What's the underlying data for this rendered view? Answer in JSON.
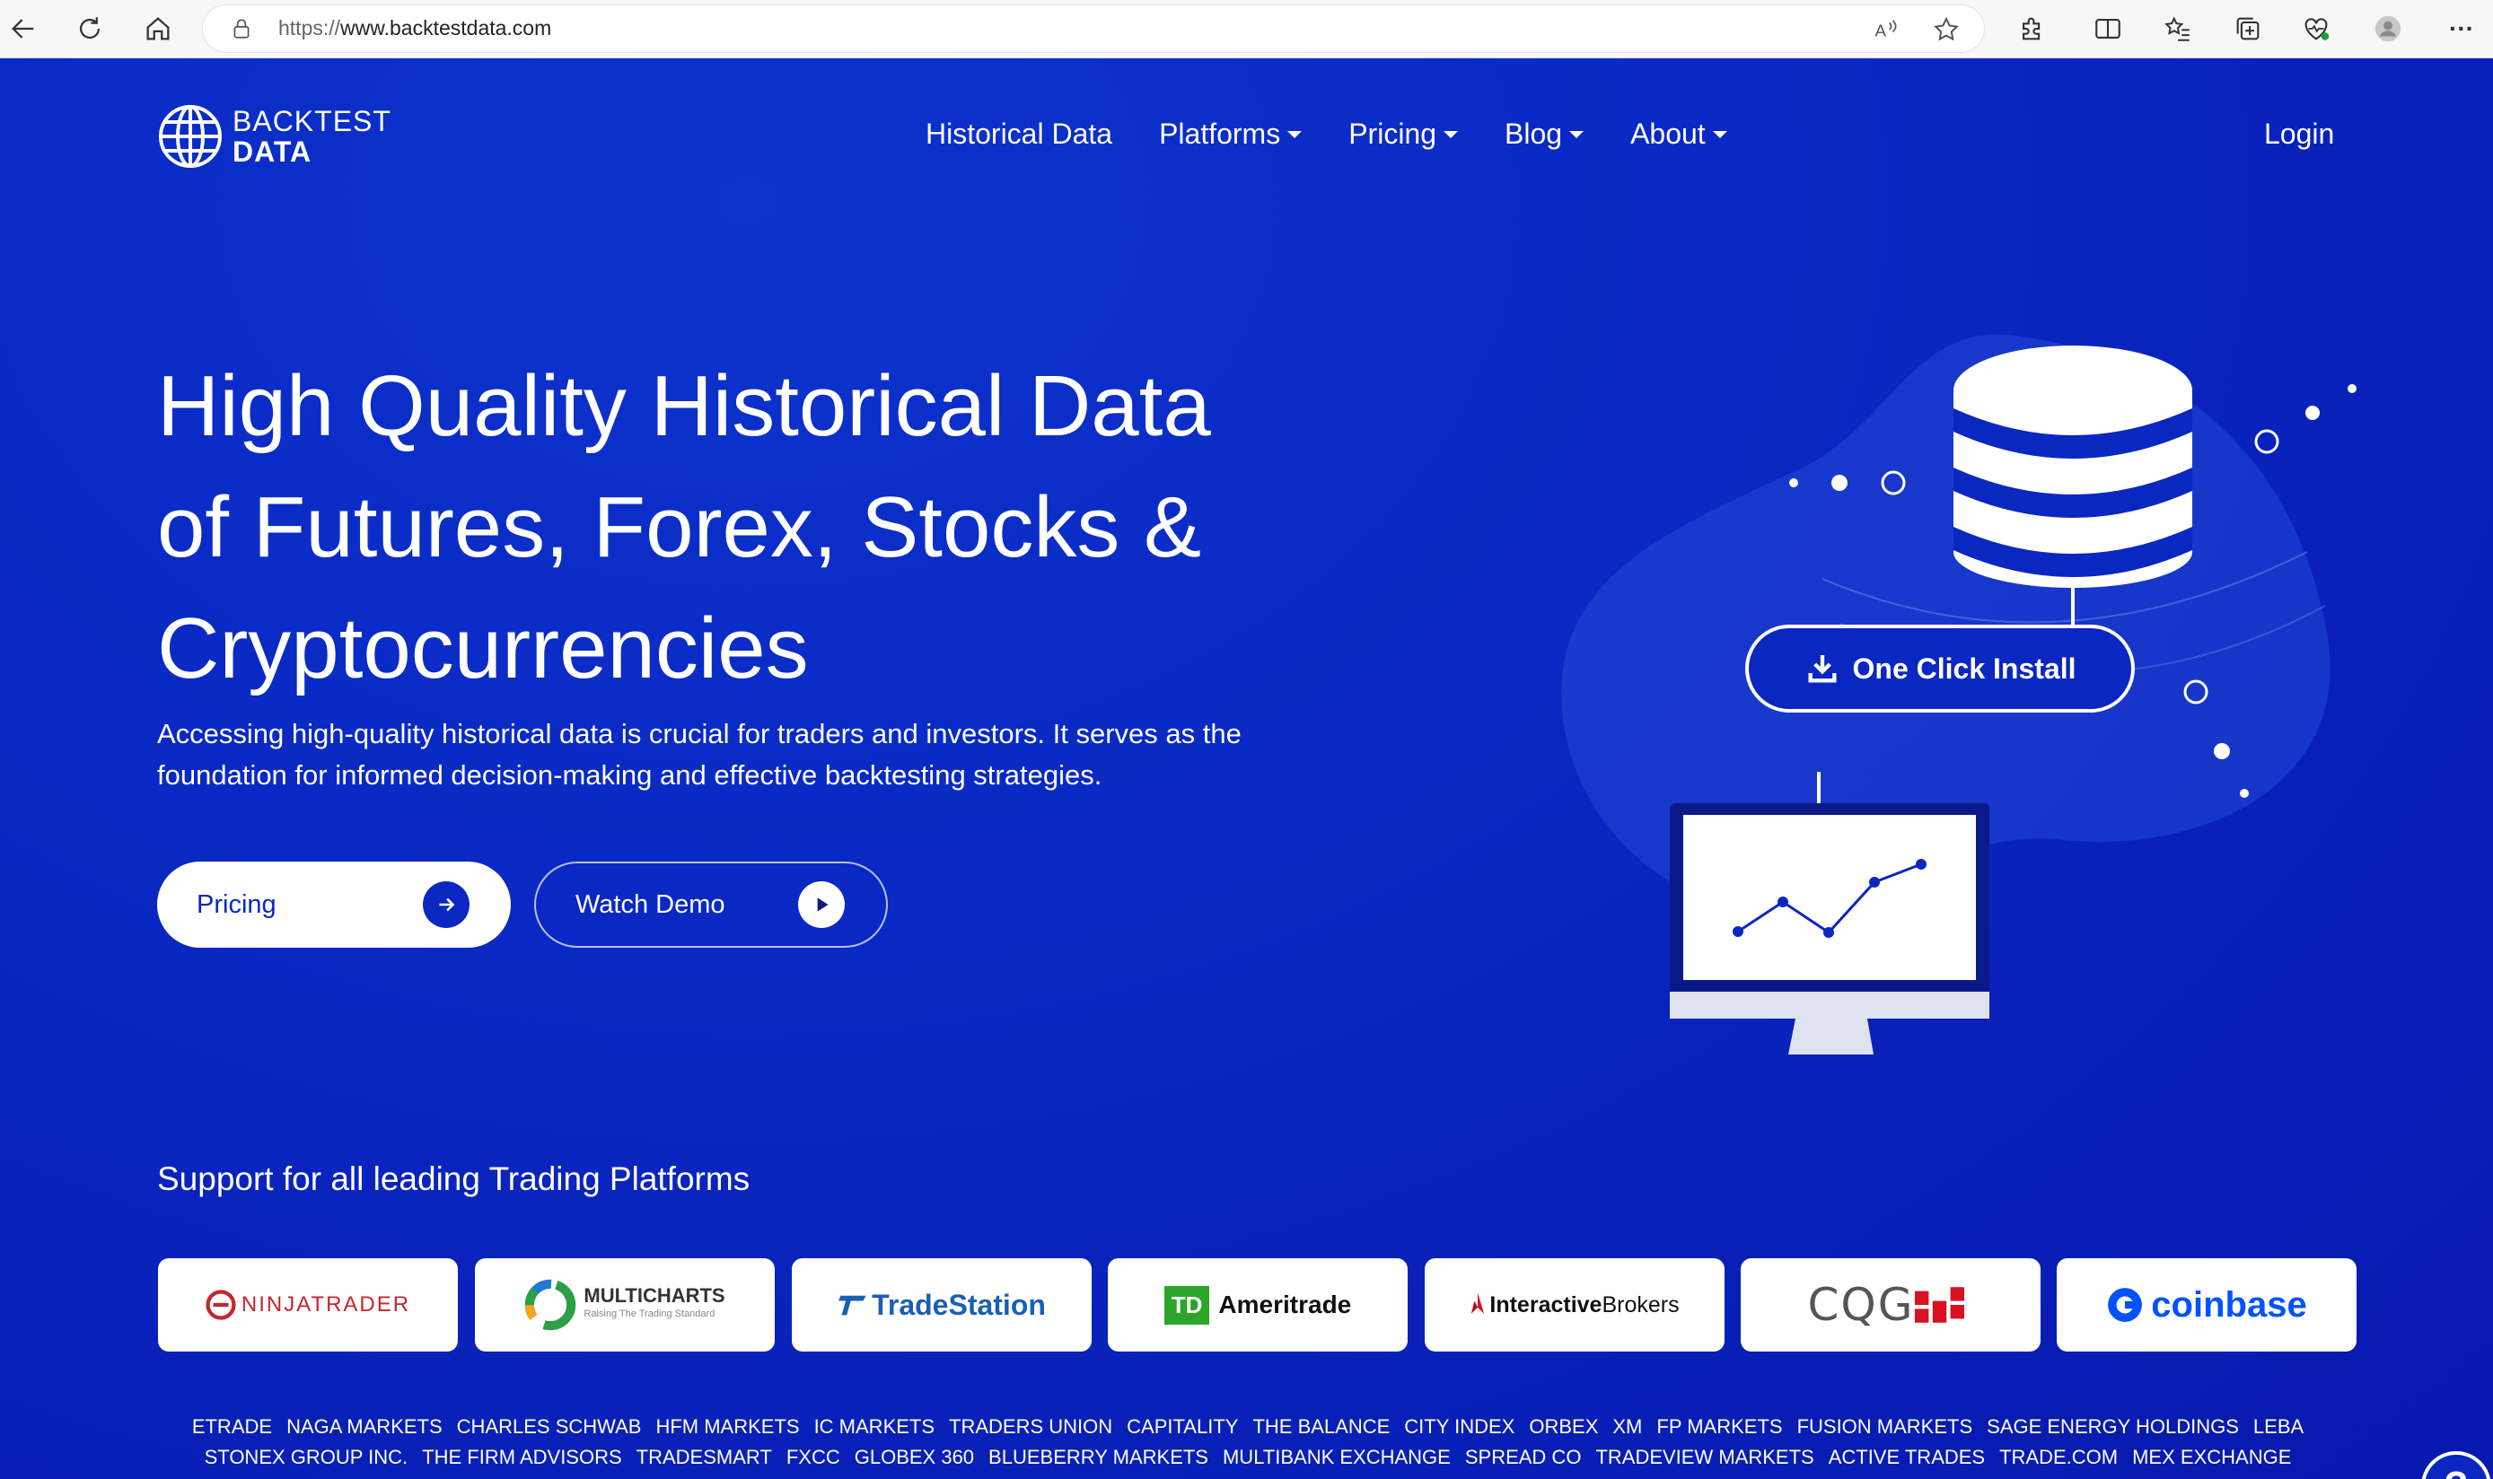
{
  "browser": {
    "url_prefix": "https://",
    "url_host": "www.backtestdata.com",
    "more_label": "···"
  },
  "site": {
    "logo_line1": "BACKTEST",
    "logo_line2": "DATA",
    "nav": [
      {
        "label": "Historical Data",
        "dropdown": false
      },
      {
        "label": "Platforms",
        "dropdown": true
      },
      {
        "label": "Pricing",
        "dropdown": true
      },
      {
        "label": "Blog",
        "dropdown": true
      },
      {
        "label": "About",
        "dropdown": true
      }
    ],
    "login_label": "Login"
  },
  "hero": {
    "title_line1": "High Quality Historical Data",
    "title_line2": "of Futures, Forex, Stocks &",
    "title_line3": "Cryptocurrencies",
    "subtitle_line1": "Accessing high-quality historical data is crucial for traders and investors. It serves as the",
    "subtitle_line2": "foundation for informed decision-making and effective backtesting strategies.",
    "pricing_button": "Pricing",
    "demo_button": "Watch Demo",
    "install_label": "One Click Install"
  },
  "support": {
    "title": "Support for all leading Trading Platforms",
    "partners": [
      {
        "name": "NINJATRADER",
        "icon": "ninjatrader-logo"
      },
      {
        "name": "MULTICHARTS",
        "tagline": "Raising The Trading Standard",
        "icon": "multicharts-logo"
      },
      {
        "name": "TradeStation",
        "icon": "tradestation-logo"
      },
      {
        "name": "Ameritrade",
        "prefix": "TD",
        "icon": "td-ameritrade-logo"
      },
      {
        "name_bold": "Interactive",
        "name_rest": "Brokers",
        "icon": "interactive-brokers-logo"
      },
      {
        "name": "CQG",
        "icon": "cqg-logo"
      },
      {
        "name": "coinbase",
        "icon": "coinbase-logo"
      }
    ],
    "brokers_row1": [
      "ETRADE",
      "NAGA MARKETS",
      "CHARLES SCHWAB",
      "HFM MARKETS",
      "IC MARKETS",
      "TRADERS UNION",
      "CAPITALITY",
      "THE BALANCE",
      "CITY INDEX",
      "ORBEX",
      "XM",
      "FP MARKETS",
      "FUSION MARKETS",
      "SAGE ENERGY HOLDINGS",
      "LEBA"
    ],
    "brokers_row2": [
      "STONEX GROUP INC.",
      "THE FIRM ADVISORS",
      "TRADESMART",
      "FXCC",
      "GLOBEX 360",
      "BLUEBERRY MARKETS",
      "MULTIBANK EXCHANGE",
      "SPREAD CO",
      "TRADEVIEW MARKETS",
      "ACTIVE TRADES",
      "TRADE.COM",
      "MEX EXCHANGE"
    ]
  },
  "help_label": "?",
  "colors": {
    "primary": "#0a27c2",
    "white": "#ffffff",
    "td_green": "#2ba62a",
    "coinbase_blue": "#0052ff",
    "ib_red": "#d81222"
  }
}
